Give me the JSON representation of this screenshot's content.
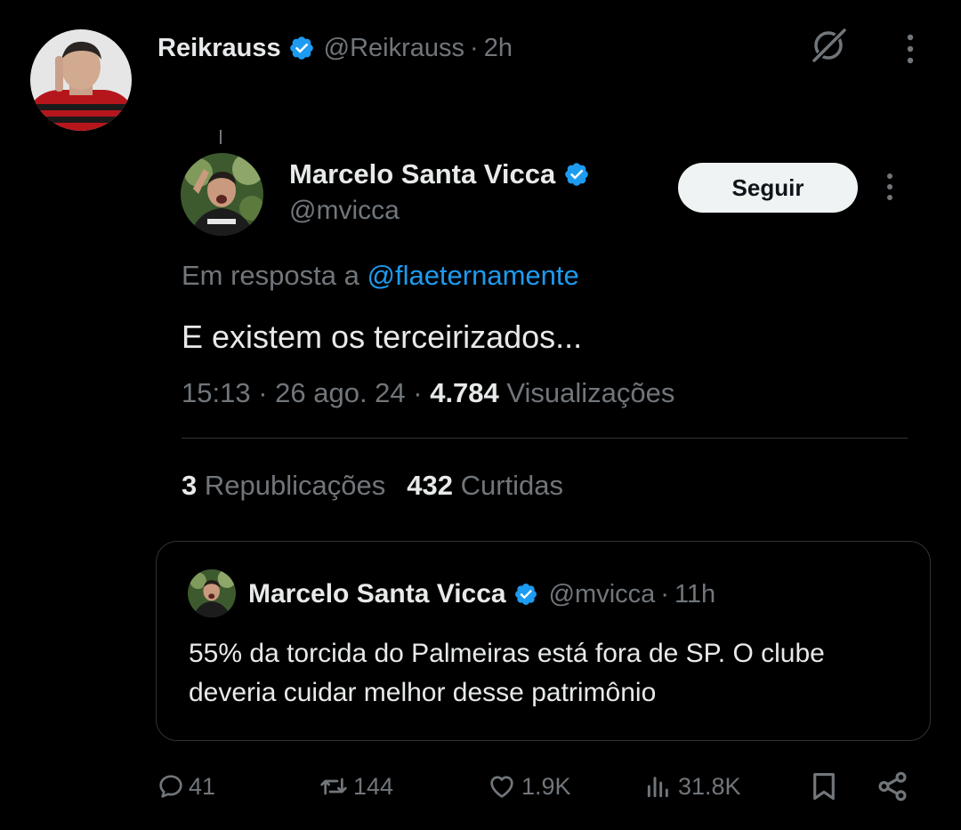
{
  "outer_tweet": {
    "author_name": "Reikrauss",
    "handle": "@Reikrauss",
    "separator": "·",
    "time": "2h",
    "icons": [
      "verified-badge-icon",
      "grok-icon",
      "more-options-icon"
    ]
  },
  "quoted_reply": {
    "author_name": "Marcelo Santa Vicca",
    "handle": "@mvicca",
    "follow_label": "Seguir",
    "reply_prefix": "Em resposta a ",
    "reply_to": "@flaeternamente",
    "text": "E existem os terceirizados...",
    "timestamp": "15:13 · 26 ago. 24 · ",
    "views_count": "4.784",
    "views_label": " Visualizações",
    "reposts_count": "3",
    "reposts_label": " Republicações",
    "likes_count": "432",
    "likes_label": " Curtidas"
  },
  "quote_card": {
    "author_name": "Marcelo Santa Vicca",
    "handle": "@mvicca",
    "separator": "·",
    "time": "11h",
    "text": "55% da torcida do Palmeiras está fora de SP. O clube deveria cuidar melhor desse patrimônio"
  },
  "actions": {
    "replies": "41",
    "retweets": "144",
    "likes": "1.9K",
    "views": "31.8K"
  },
  "colors": {
    "background": "#000000",
    "text_primary": "#e7e9ea",
    "text_secondary": "#71767b",
    "link": "#1d9bf0",
    "verified": "#1d9bf0",
    "border": "#2f3336"
  }
}
